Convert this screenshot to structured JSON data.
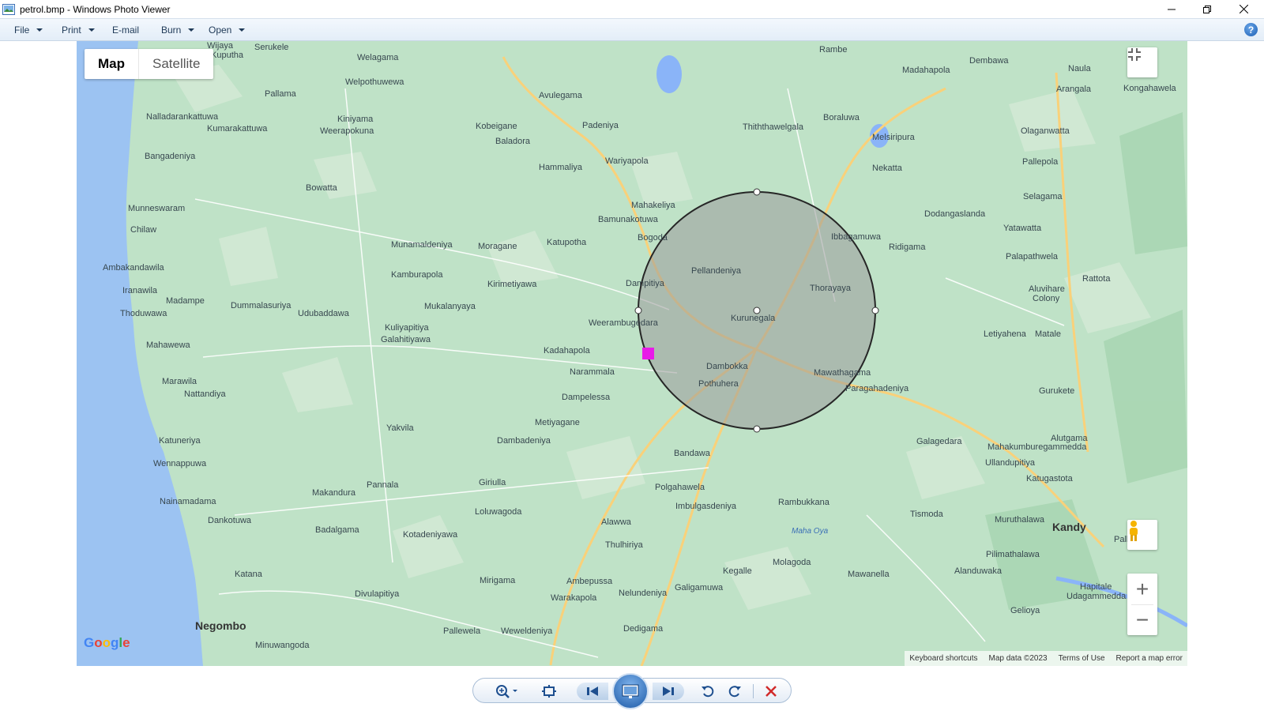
{
  "window": {
    "title": "petrol.bmp - Windows Photo Viewer",
    "controls": [
      "minimize-icon",
      "restore-icon",
      "close-icon"
    ]
  },
  "menu": {
    "items": [
      {
        "label": "File",
        "has_arrow": true
      },
      {
        "label": "Print",
        "has_arrow": true
      },
      {
        "label": "E-mail",
        "has_arrow": false
      },
      {
        "label": "Burn",
        "has_arrow": true
      },
      {
        "label": "Open",
        "has_arrow": true
      }
    ],
    "help_label": "?"
  },
  "map": {
    "type_control": {
      "map_label": "Map",
      "satellite_label": "Satellite",
      "selected": "Map"
    },
    "google_logo": "Google",
    "attribution": {
      "shortcuts": "Keyboard shortcuts",
      "data": "Map data ©2023",
      "terms": "Terms of Use",
      "report": "Report a map error"
    },
    "zoom_in": "+",
    "zoom_out": "−",
    "colors": {
      "land": "#bfe2c7",
      "water": "#8ab4f8",
      "road": "#f9d17a",
      "circle_fill": "#9a9a9a",
      "marker": "#e81ae8"
    },
    "places": {
      "Wijaya Kuputha": "Wijaya",
      "Kuputha": "Kuputha",
      "Serukele": "Serukele",
      "Welagama": "Welagama",
      "Rambe": "Rambe",
      "Dembawa": "Dembawa",
      "Madahapola": "Madahapola",
      "Naula": "Naula",
      "Arangala": "Arangala",
      "Kongahawela": "Kongahawela",
      "Welpothuwewa": "Welpothuwewa",
      "Pallama": "Pallama",
      "Avulegama": "Avulegama",
      "Nalladarankattuwa": "Nalladarankattuwa",
      "Kiniyama": "Kiniyama",
      "Kumarakattuwa": "Kumarakattuwa",
      "Weerapokuna": "Weerapokuna",
      "Kobeigane": "Kobeigane",
      "Padeniya": "Padeniya",
      "Boraluwa": "Boraluwa",
      "Thiththawelgala": "Thiththawelgala",
      "Melsiripura": "Melsiripura",
      "Olaganwatta": "Olaganwatta",
      "Baladora": "Baladora",
      "Bangadeniya": "Bangadeniya",
      "Hammaliya": "Hammaliya",
      "Wariyapola": "Wariyapola",
      "Nekatta": "Nekatta",
      "Pallepola": "Pallepola",
      "Bowatta": "Bowatta",
      "Selagama": "Selagama",
      "Munneswaram": "Munneswaram",
      "Mahakeliya": "Mahakeliya",
      "Dodangaslanda": "Dodangaslanda",
      "Chilaw": "Chilaw",
      "Bamunakotuwa": "Bamunakotuwa",
      "Yatawatta": "Yatawatta",
      "Ibbagamuwa": "Ibbagamuwa",
      "Katupotha": "Katupotha",
      "Bogoda": "Bogoda",
      "Munamaldeniya": "Munamaldeniya",
      "Moragane": "Moragane",
      "Ridigama": "Ridigama",
      "Palapathwela": "Palapathwela",
      "Ambakandawila": "Ambakandawila",
      "Pellandeniya": "Pellandeniya",
      "Kamburapola": "Kamburapola",
      "Rattota": "Rattota",
      "Kirimetiyawa": "Kirimetiyawa",
      "Dampitiya": "Dampitiya",
      "Thorayaya": "Thorayaya",
      "Iranawila": "Iranawila",
      "Aluvihare": "Aluvihare",
      "Colony": "Colony",
      "Madampe": "Madampe",
      "Dummalasuriya": "Dummalasuriya",
      "Mukalanyaya": "Mukalanyaya",
      "Thoduwawa": "Thoduwawa",
      "Udubaddawa": "Udubaddawa",
      "Kurunegala": "Kurunegala",
      "Kuliyapitiya": "Kuliyapitiya",
      "Weerambugedara": "Weerambugedara",
      "Galahitiyawa": "Galahitiyawa",
      "Letiyahena": "Letiyahena",
      "Matale": "Matale",
      "Mahawewa": "Mahawewa",
      "Kadahapola": "Kadahapola",
      "Dambokka": "Dambokka",
      "Mawathagama": "Mawathagama",
      "Narammala": "Narammala",
      "Marawila": "Marawila",
      "Nattandiya": "Nattandiya",
      "Pothuhera": "Pothuhera",
      "Paragahadeniya": "Paragahadeniya",
      "Gurukete": "Gurukete",
      "Dampelessa": "Dampelessa",
      "Katuneriya": "Katuneriya",
      "Yakvila": "Yakvila",
      "Metiyagane": "Metiyagane",
      "Alutgama": "Alutgama",
      "Dambadeniya": "Dambadeniya",
      "Galagedara": "Galagedara",
      "Mahakumburegammedda": "Mahakumburegammedda",
      "Wennappuwa": "Wennappuwa",
      "Bandawa": "Bandawa",
      "Ullandupitiya": "Ullandupitiya",
      "Pannala": "Pannala",
      "Giriulla": "Giriulla",
      "Polgahawela": "Polgahawela",
      "Katugastota": "Katugastota",
      "Nainamadama": "Nainamadama",
      "Makandura": "Makandura",
      "Loluwagoda": "Loluwagoda",
      "Rambukkana": "Rambukkana",
      "Imbulgasdeniya": "Imbulgasdeniya",
      "Tismoda": "Tismoda",
      "Dankotuwa": "Dankotuwa",
      "Muruthalawa": "Muruthalawa",
      "Kandy": "Kandy",
      "Badalgama": "Badalgama",
      "Kotadeniyawa": "Kotadeniyawa",
      "Alawwa": "Alawwa",
      "Maha Oya": "Maha Oya",
      "Thulhiriya": "Thulhiriya",
      "Palle": "Palle",
      "Pilimathalawa": "Pilimathalawa",
      "Mawanella": "Mawanella",
      "Molagoda": "Molagoda",
      "Katana": "Katana",
      "Alanduwaka": "Alanduwaka",
      "Kegalle": "Kegalle",
      "Mirigama": "Mirigama",
      "Ambepussa": "Ambepussa",
      "Divulapitiya": "Divulapitiya",
      "Galigamuwa": "Galigamuwa",
      "Hapitale": "Hapitale",
      "Udagammedda": "Udagammedda",
      "Warakapola": "Warakapola",
      "Nelundeniya": "Nelundeniya",
      "Gelioya": "Gelioya",
      "Negombo": "Negombo",
      "Dedigama": "Dedigama",
      "Pallewela": "Pallewela",
      "Weweldeniya": "Weweldeniya",
      "Minuwangoda": "Minuwangoda"
    }
  },
  "toolbar": {
    "buttons": [
      "zoom-icon",
      "actual-size-icon",
      "previous-icon",
      "slideshow-icon",
      "next-icon",
      "rotate-left-icon",
      "rotate-right-icon",
      "delete-icon"
    ]
  }
}
